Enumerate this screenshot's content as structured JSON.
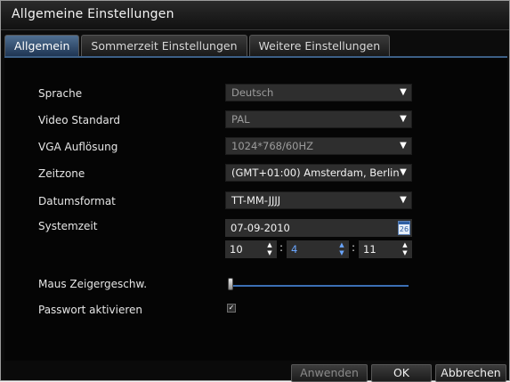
{
  "window": {
    "title": "Allgemeine Einstellungen"
  },
  "tabs": [
    {
      "label": "Allgemein",
      "active": true
    },
    {
      "label": "Sommerzeit Einstellungen",
      "active": false
    },
    {
      "label": "Weitere Einstellungen",
      "active": false
    }
  ],
  "settings": {
    "language": {
      "label": "Sprache",
      "value": "Deutsch"
    },
    "video_standard": {
      "label": "Video Standard",
      "value": "PAL"
    },
    "vga_resolution": {
      "label": "VGA Auflösung",
      "value": "1024*768/60HZ"
    },
    "timezone": {
      "label": "Zeitzone",
      "value": "(GMT+01:00) Amsterdam, Berlin"
    },
    "date_format": {
      "label": "Datumsformat",
      "value": "TT-MM-JJJJ"
    },
    "system_time": {
      "label": "Systemzeit",
      "date": "07-09-2010",
      "calendar_day": "26",
      "hour": "10",
      "minute": "4",
      "second": "11"
    },
    "mouse_speed": {
      "label": "Maus Zeigergeschw.",
      "level": 0.0
    },
    "password": {
      "label": "Passwort aktivieren",
      "checked": true,
      "check_glyph": "✓"
    }
  },
  "buttons": {
    "apply": "Anwenden",
    "ok": "OK",
    "cancel": "Abbrechen"
  },
  "icons": {
    "dropdown": "chevron-down-icon",
    "calendar": "calendar-icon",
    "spinner_up": "▲",
    "spinner_down": "▼"
  },
  "colors": {
    "accent": "#3c5f86",
    "background": "#050505",
    "field": "#2e2e2e"
  }
}
